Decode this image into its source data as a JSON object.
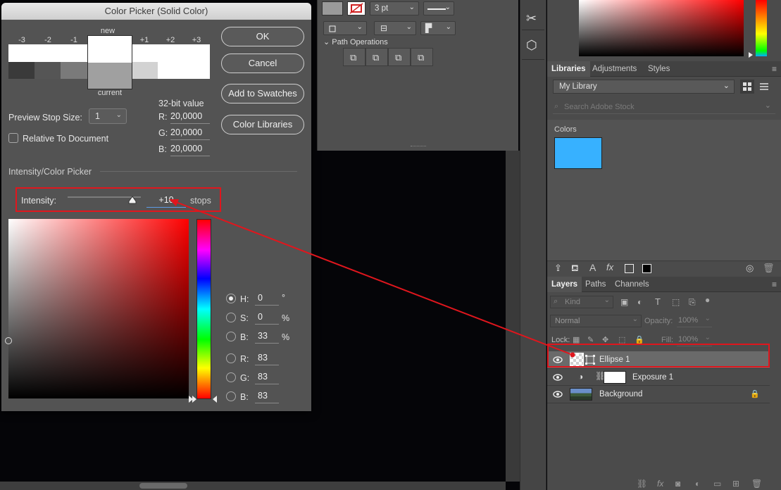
{
  "dialog": {
    "title": "Color Picker (Solid Color)",
    "stops": [
      "-3",
      "-2",
      "-1",
      "+1",
      "+2",
      "+3"
    ],
    "new_label": "new",
    "current_label": "current",
    "buttons": {
      "ok": "OK",
      "cancel": "Cancel",
      "add_swatches": "Add to Swatches",
      "color_libraries": "Color Libraries"
    },
    "bit_value_label": "32-bit value",
    "r_label": "R:",
    "r_value": "20,0000",
    "g_label": "G:",
    "g_value": "20,0000",
    "b_label": "B:",
    "b_value": "20,0000",
    "preview_stop_label": "Preview Stop Size:",
    "preview_stop_value": "1",
    "relative_label": "Relative To Document",
    "section_label": "Intensity/Color Picker",
    "intensity_label": "Intensity:",
    "intensity_value": "+10",
    "intensity_unit": "stops",
    "fields": [
      {
        "key": "h",
        "label": "H:",
        "value": "0",
        "unit": "°"
      },
      {
        "key": "s",
        "label": "S:",
        "value": "0",
        "unit": "%"
      },
      {
        "key": "b",
        "label": "B:",
        "value": "33",
        "unit": "%"
      },
      {
        "key": "r",
        "label": "R:",
        "value": "83",
        "unit": ""
      },
      {
        "key": "g",
        "label": "G:",
        "value": "83",
        "unit": ""
      },
      {
        "key": "bb",
        "label": "B:",
        "value": "83",
        "unit": ""
      }
    ]
  },
  "options": {
    "stroke_width": "3 pt",
    "path_ops_label": "Path Operations"
  },
  "libraries": {
    "tabs": [
      "Libraries",
      "Adjustments",
      "Styles"
    ],
    "library_name": "My Library",
    "search_placeholder": "Search Adobe Stock",
    "colors_label": "Colors",
    "color_swatch": "#37b1ff"
  },
  "layers": {
    "tabs": [
      "Layers",
      "Paths",
      "Channels"
    ],
    "kind_label": "Kind",
    "blend_mode": "Normal",
    "opacity_label": "Opacity:",
    "opacity_value": "100%",
    "lock_label": "Lock:",
    "fill_label": "Fill:",
    "fill_value": "100%",
    "rows": [
      {
        "name": "Ellipse 1"
      },
      {
        "name": "Exposure 1"
      },
      {
        "name": "Background"
      }
    ]
  },
  "colors": {
    "highlight": "#e0161d",
    "accent_blue": "#37b1ff"
  }
}
